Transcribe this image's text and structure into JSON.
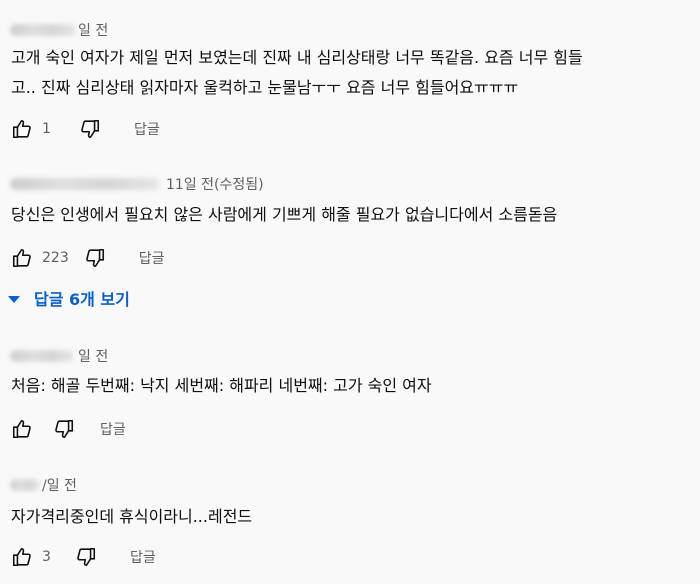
{
  "comments": [
    {
      "author_hidden": true,
      "timestamp": "일 전",
      "text_lines": [
        "고개 숙인 여자가 제일 먼저 보였는데 진짜 내 심리상태랑 너무 똑같음. 요즘 너무 힘들",
        "고.. 진짜 심리상태 읽자마자 울컥하고 눈물남ㅜㅜ 요즘 너무 힘들어요ㅠㅠㅠ"
      ],
      "like_count": "1",
      "reply_label": "답글"
    },
    {
      "author_hidden": true,
      "timestamp": "11일 전(수정됨)",
      "text_lines": [
        "당신은 인생에서 필요치 않은 사람에게 기쁘게 해줄 필요가 없습니다에서 소름돋음"
      ],
      "like_count": "223",
      "reply_label": "답글"
    },
    {
      "author_hidden": true,
      "timestamp": "일 전",
      "text_lines": [
        "처음: 해골 두번째: 낙지 세번째: 해파리 네번째: 고가 숙인 여자"
      ],
      "like_count": "",
      "reply_label": "답글"
    },
    {
      "author_hidden": true,
      "timestamp": "/일 전",
      "text_lines": [
        "자가격리중인데 휴식이라니...레전드"
      ],
      "like_count": "3",
      "reply_label": "답글"
    }
  ],
  "replies_toggle": {
    "label": "답글 6개 보기"
  },
  "icons": {
    "like": "thumbs-up-icon",
    "dislike": "thumbs-down-icon",
    "expand": "caret-down-icon"
  },
  "colors": {
    "background": "#f9f9f9",
    "text": "#0f0f0f",
    "secondary_text": "#606060",
    "link_blue": "#065fd4"
  }
}
